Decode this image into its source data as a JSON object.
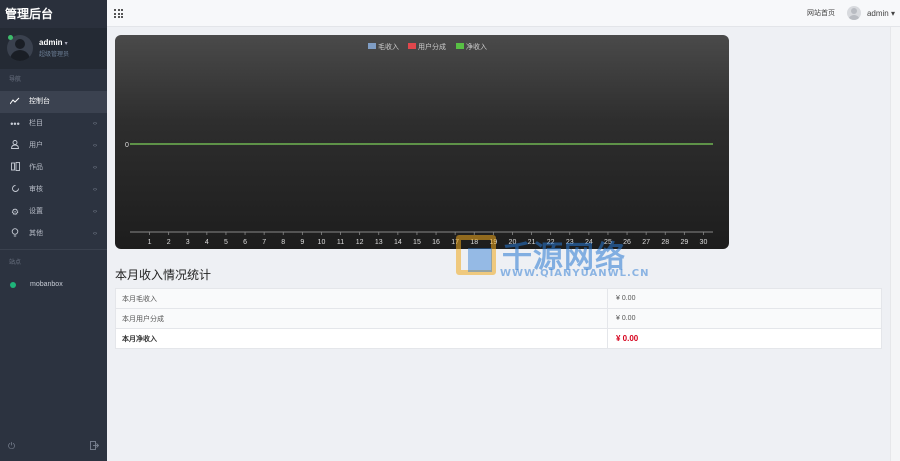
{
  "brand": {
    "title": "管理后台"
  },
  "user": {
    "name": "admin",
    "role": "超级管理员"
  },
  "sidebar": {
    "section_label": "导航",
    "items": [
      {
        "label": "控制台",
        "icon": "trend-line-icon",
        "active": true
      },
      {
        "label": "栏目",
        "icon": "dots-icon"
      },
      {
        "label": "用户",
        "icon": "user-icon"
      },
      {
        "label": "作品",
        "icon": "columns-icon"
      },
      {
        "label": "审核",
        "icon": "refresh-icon"
      },
      {
        "label": "设置",
        "icon": "gear-icon"
      },
      {
        "label": "其他",
        "icon": "bulb-icon"
      }
    ],
    "sites_label": "站点",
    "sites": [
      {
        "label": "mobanbox",
        "status_color": "#1fb57a"
      }
    ]
  },
  "topbar": {
    "home_link": "网站首页",
    "user": "admin"
  },
  "chart_data": {
    "type": "line",
    "title": "",
    "legend": [
      "毛收入",
      "用户分成",
      "净收入"
    ],
    "legend_position": "top-center",
    "colors": [
      "#7f9dc4",
      "#e0474c",
      "#58c044"
    ],
    "x": [
      1,
      2,
      3,
      4,
      5,
      6,
      7,
      8,
      9,
      10,
      11,
      12,
      13,
      14,
      15,
      16,
      17,
      18,
      19,
      20,
      21,
      22,
      23,
      24,
      25,
      26,
      27,
      28,
      29,
      30
    ],
    "series": [
      {
        "name": "毛收入",
        "values": [
          0,
          0,
          0,
          0,
          0,
          0,
          0,
          0,
          0,
          0,
          0,
          0,
          0,
          0,
          0,
          0,
          0,
          0,
          0,
          0,
          0,
          0,
          0,
          0,
          0,
          0,
          0,
          0,
          0,
          0
        ]
      },
      {
        "name": "用户分成",
        "values": [
          0,
          0,
          0,
          0,
          0,
          0,
          0,
          0,
          0,
          0,
          0,
          0,
          0,
          0,
          0,
          0,
          0,
          0,
          0,
          0,
          0,
          0,
          0,
          0,
          0,
          0,
          0,
          0,
          0,
          0
        ]
      },
      {
        "name": "净收入",
        "values": [
          0,
          0,
          0,
          0,
          0,
          0,
          0,
          0,
          0,
          0,
          0,
          0,
          0,
          0,
          0,
          0,
          0,
          0,
          0,
          0,
          0,
          0,
          0,
          0,
          0,
          0,
          0,
          0,
          0,
          0
        ]
      }
    ],
    "y_tick": "0",
    "grid": false
  },
  "stats": {
    "title": "本月收入情况统计",
    "rows": [
      {
        "label": "本月毛收入",
        "value": "¥ 0.00"
      },
      {
        "label": "本月用户分成",
        "value": "¥ 0.00"
      },
      {
        "label": "本月净收入",
        "value": "¥ 0.00"
      }
    ]
  },
  "watermark": {
    "text": "千源网络",
    "url": "WWW.QIANYUANWL.CN"
  }
}
